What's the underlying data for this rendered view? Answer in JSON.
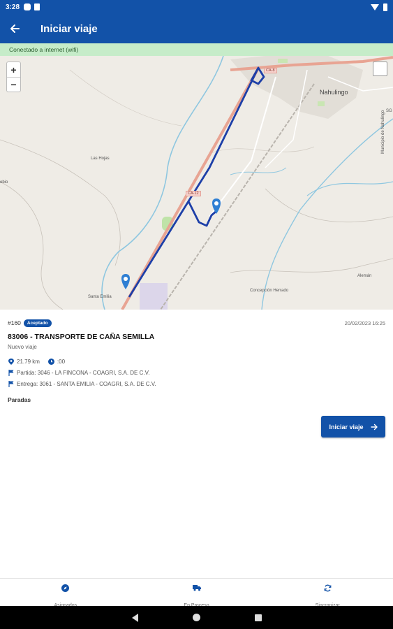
{
  "status_bar": {
    "time": "3:28"
  },
  "app_bar": {
    "title": "Iniciar viaje"
  },
  "connection": {
    "text": "Conectado a internet (wifi)"
  },
  "map": {
    "zoom_in": "+",
    "zoom_out": "−",
    "labels": {
      "nahulingo": "Nahulingo",
      "las_hojas": "Las Hojas",
      "santa_emilia": "Santa Emilia",
      "concepcion": "Concepción Herrado",
      "aleman": "Alemán",
      "ca8": "CA-8",
      "ca12": "CA-12",
      "ero": "ebio",
      "sg": "SG",
      "municipio": "Municipio de Nahulingo"
    },
    "colors": {
      "route": "#1d3fa8",
      "highway": "#e8a493",
      "river": "#8fc7e0",
      "pin": "#2f7fd3"
    }
  },
  "trip": {
    "number": "#160",
    "status": "Aceptado",
    "date": "20/02/2023 16:25",
    "title": "83006 - TRANSPORTE DE CAÑA SEMILLA",
    "subtitle": "Nuevo viaje",
    "distance": "21.79 km",
    "duration": ":00",
    "departure": "Partida: 3046 - LA FINCONA - COAGRI, S.A. DE C.V.",
    "delivery": "Entrega: 3061 - SANTA EMILIA - COAGRI, S.A. DE C.V.",
    "stops_label": "Paradas"
  },
  "actions": {
    "start_label": "Iniciar viaje"
  },
  "bottom_nav": [
    {
      "label": "Asignados",
      "icon": "compass-icon"
    },
    {
      "label": "En Proceso",
      "icon": "truck-icon"
    },
    {
      "label": "Sincronizar",
      "icon": "sync-icon"
    }
  ]
}
